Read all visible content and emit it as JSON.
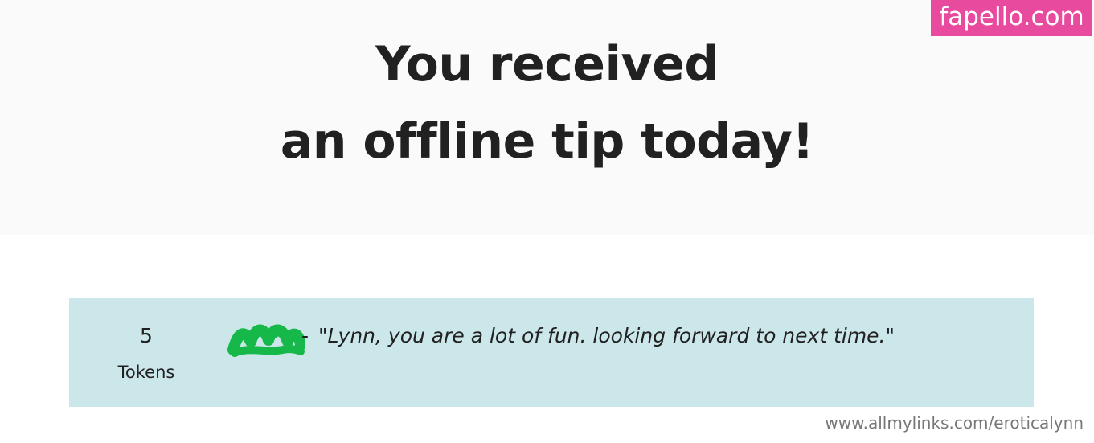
{
  "header": {
    "line1": "You received",
    "line2": "an offline tip today!"
  },
  "watermark": {
    "text": "fapello.com",
    "color": "#e84a9e"
  },
  "tip": {
    "amount": "5",
    "unit": "Tokens",
    "separator": "-",
    "message": "\"Lynn, you are a lot of fun. looking forward to next time.\"",
    "card_color": "#cce7ea",
    "redaction_color": "#16b84a"
  },
  "footer": {
    "url": "www.allmylinks.com/eroticalynn"
  }
}
